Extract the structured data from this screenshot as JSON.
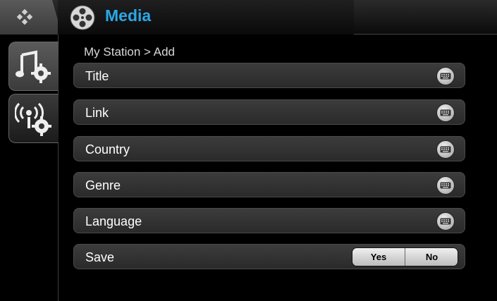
{
  "header": {
    "title": "Media",
    "home_icon": "diamond-grid-icon",
    "app_icon": "film-reel-icon"
  },
  "sidebar": {
    "items": [
      {
        "name": "music-settings",
        "icon": "music-note-gear-icon"
      },
      {
        "name": "radio-settings",
        "icon": "radio-signal-gear-icon"
      }
    ]
  },
  "breadcrumb": "My Station > Add",
  "fields": [
    {
      "label": "Title",
      "action_icon": "keyboard-icon"
    },
    {
      "label": "Link",
      "action_icon": "keyboard-icon"
    },
    {
      "label": "Country",
      "action_icon": "keyboard-icon"
    },
    {
      "label": "Genre",
      "action_icon": "keyboard-icon"
    },
    {
      "label": "Language",
      "action_icon": "keyboard-icon"
    }
  ],
  "save": {
    "label": "Save",
    "yes": "Yes",
    "no": "No"
  },
  "colors": {
    "accent": "#2aa7e8",
    "background": "#000000",
    "row": "#333333"
  }
}
